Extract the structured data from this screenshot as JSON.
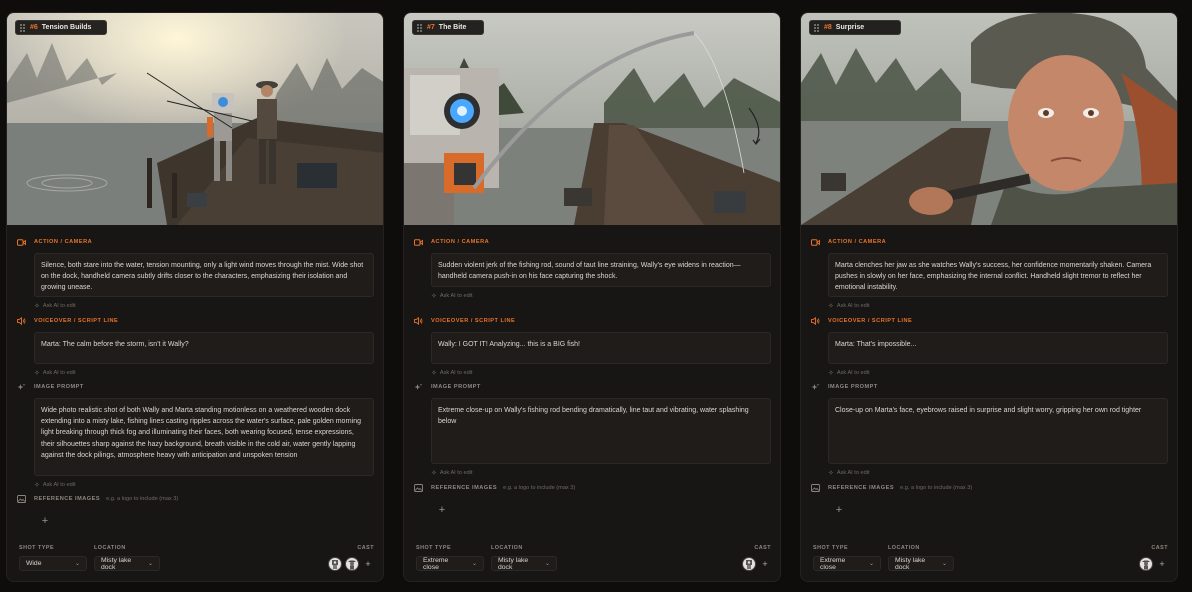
{
  "labels": {
    "action": "ACTION / CAMERA",
    "voiceover": "VOICEOVER / SCRIPT LINE",
    "image_prompt": "IMAGE PROMPT",
    "reference": "REFERENCE IMAGES",
    "reference_hint": "e.g. a logo to include (max 3)",
    "ask_ai": "Ask AI to edit",
    "shot_type": "SHOT TYPE",
    "location": "LOCATION",
    "cast": "CAST",
    "add": "+"
  },
  "icons": {
    "action": "video-camera-icon",
    "voiceover": "speaker-icon",
    "image_prompt": "sparkles-icon",
    "reference": "image-icon",
    "grip": "drag-handle-icon",
    "chevron": "chevron-down-icon"
  },
  "colors": {
    "accent": "#e8732c",
    "card_bg": "#181614",
    "page_bg": "#0e0d0c"
  },
  "shots": [
    {
      "number": "#6",
      "title": "Tension Builds",
      "action": "Silence, both stare into the water, tension mounting, only a light wind moves through the mist. Wide shot on the dock, handheld camera subtly drifts closer to the characters, emphasizing their isolation and growing unease.",
      "voiceover": "Marta: The calm before the storm, isn't it Wally?",
      "image_prompt": "Wide photo realistic shot of both Wally and Marta standing motionless on a weathered wooden dock extending into a misty lake, fishing lines casting ripples across the water's surface, pale golden morning light breaking through thick fog and illuminating their faces, both wearing focused, tense expressions, their silhouettes sharp against the hazy background, breath visible in the cold air, water gently lapping against the dock pilings, atmosphere heavy with anticipation and unspoken tension",
      "shot_type": "Wide",
      "location": "Misty lake dock",
      "cast": [
        "wally-avatar",
        "marta-avatar"
      ]
    },
    {
      "number": "#7",
      "title": "The Bite",
      "action": "Sudden violent jerk of the fishing rod, sound of taut line straining, Wally's eye widens in reaction—handheld camera push-in on his face capturing the shock.",
      "voiceover": "Wally: I GOT IT! Analyzing... this is a BIG fish!",
      "image_prompt": "Extreme close-up on Wally's fishing rod bending dramatically, line taut and vibrating, water splashing below",
      "shot_type": "Extreme close",
      "location": "Misty lake dock",
      "cast": [
        "wally-avatar"
      ]
    },
    {
      "number": "#8",
      "title": "Surprise",
      "action": "Marta clenches her jaw as she watches Wally's success, her confidence momentarily shaken. Camera pushes in slowly on her face, emphasizing the internal conflict. Handheld slight tremor to reflect her emotional instability.",
      "voiceover": "Marta: That's impossible...",
      "image_prompt": "Close-up on Marta's face, eyebrows raised in surprise and slight worry, gripping her own rod tighter",
      "shot_type": "Extreme close",
      "location": "Misty lake dock",
      "cast": [
        "marta-avatar"
      ]
    }
  ]
}
